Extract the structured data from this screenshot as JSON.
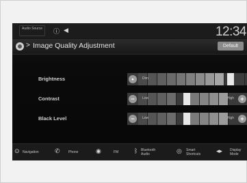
{
  "status_bar": {
    "audio_source_label": "Audio Source",
    "clock": "12:34",
    "icons": [
      "info-icon",
      "speaker-icon"
    ]
  },
  "header": {
    "breadcrumb_separator": ">",
    "title": "Image Quality Adjustment",
    "default_button": "Default"
  },
  "settings": [
    {
      "label": "Brightness",
      "low": "Dim",
      "high": "",
      "level": 0.84
    },
    {
      "label": "Contrast",
      "low": "Low",
      "high": "High",
      "level": 0.5
    },
    {
      "label": "Black Level",
      "low": "Low",
      "high": "High",
      "level": 0.5
    }
  ],
  "nav_bar": {
    "items": [
      {
        "label": "Navigation",
        "icon": "navigation-icon"
      },
      {
        "label": "Phone",
        "icon": "phone-icon"
      },
      {
        "label": "FM",
        "icon": "radio-icon"
      },
      {
        "label": "Bluetooth Audio",
        "icon": "bluetooth-icon"
      },
      {
        "label": "Smart Shortcuts",
        "icon": "shortcuts-icon"
      },
      {
        "label": "Display Mode",
        "icon": "display-mode-icon"
      }
    ]
  },
  "colors": {
    "screen_bg": "#0b0b0b",
    "slider_fill": "#e8e8e8",
    "button_grey": "#8a8a8a"
  }
}
